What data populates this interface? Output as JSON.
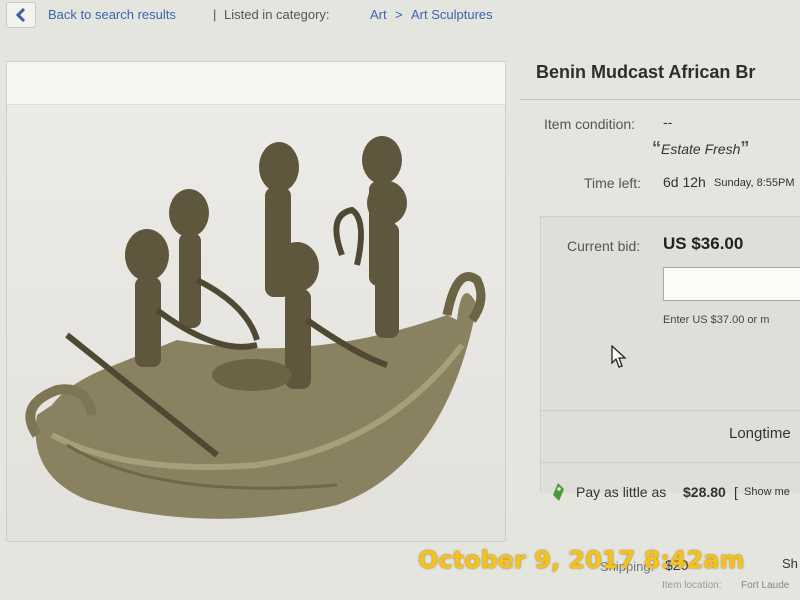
{
  "nav": {
    "back_label": "Back to search results",
    "divider": "|",
    "category_prefix": "Listed in category:",
    "crumb_1": "Art",
    "crumb_sep": ">",
    "crumb_2": "Art Sculptures"
  },
  "listing": {
    "title": "Benin Mudcast African Br",
    "condition_label": "Item condition:",
    "condition_value": "--",
    "condition_note": "Estate Fresh",
    "time_left_label": "Time left:",
    "time_left_value": "6d 12h",
    "time_left_end": "Sunday, 8:55PM",
    "current_bid_label": "Current bid:",
    "current_bid_value": "US $36.00",
    "bid_hint": "Enter US $37.00 or m",
    "longtime_label": "Longtime",
    "pay_prefix": "Pay as little as",
    "pay_amount": "$28.80",
    "pay_bracket": "[",
    "pay_link": "Show me",
    "shipping_label": "Shipping:",
    "shipping_value": "$20",
    "shipping_suffix": "Sh",
    "item_location_label": "Item location:",
    "item_location_value": "Fort Laude"
  },
  "overlay": {
    "timestamp": "October 9, 2017 8:42am"
  },
  "colors": {
    "link": "#3d63b0",
    "watermark": "#f5c21b",
    "pay_icon": "#4a9a3a"
  }
}
